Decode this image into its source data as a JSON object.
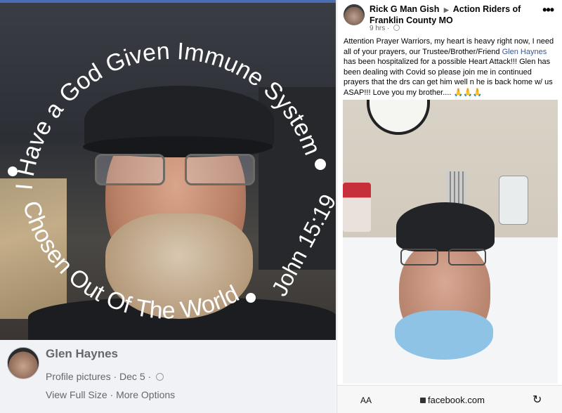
{
  "left_post": {
    "overlay_text": {
      "top_arc": "I Have a God Given Immune System",
      "bottom_arc": "Chosen Out Of The World",
      "verse": "John 15:19"
    },
    "poster_name": "Glen Haynes",
    "meta": "Profile pictures · Dec 5 ·",
    "links": "View Full Size · More Options"
  },
  "right_post": {
    "author": "Rick G Man Gish",
    "group": "Action Riders of Franklin County MO",
    "time": "9 hrs ·",
    "more": "•••",
    "body_before": "Attention Prayer Warriors, my heart is heavy right now, I need all of your prayers, our Trustee/Brother/Friend ",
    "tagged": "Glen Haynes",
    "body_after": " has been hospitalized for a possible Heart Attack!!! Glen has been dealing with Covid so please join me in continued prayers that the drs can get him well n he is back home w/ us ASAP!!! Love you my brother.... 🙏🙏🙏"
  },
  "browser": {
    "aa": "AA",
    "url": "facebook.com",
    "reload": "↻"
  }
}
